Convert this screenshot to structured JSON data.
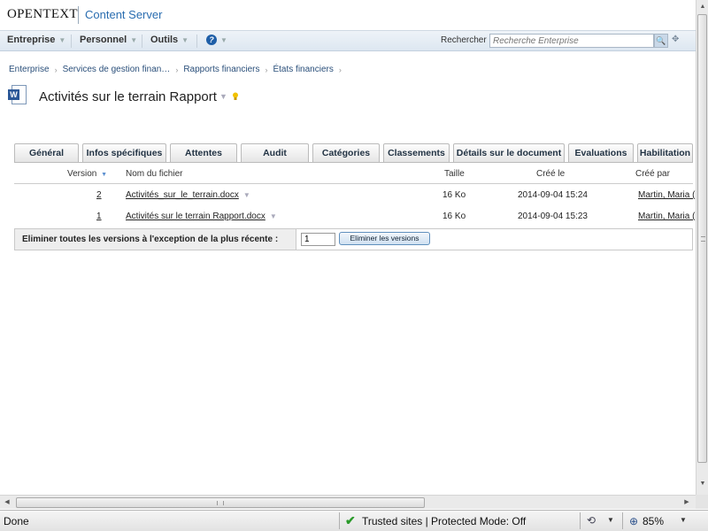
{
  "header": {
    "logo": "OPENTEXT",
    "product": "Content Server"
  },
  "nav": {
    "items": [
      "Entreprise",
      "Personnel",
      "Outils"
    ],
    "help_glyph": "?",
    "search_label": "Rechercher",
    "search_placeholder": "Recherche Enterprise"
  },
  "breadcrumb": [
    "Enterprise",
    "Services de gestion finan…",
    "Rapports financiers",
    "États financiers"
  ],
  "page": {
    "title": "Activités sur le terrain Rapport",
    "icon": "word-document-icon"
  },
  "tabs": [
    "Général",
    "Infos spécifiques",
    "Attentes",
    "Audit",
    "Catégories",
    "Classements",
    "Détails sur le document",
    "Evaluations",
    "Habilitation"
  ],
  "table": {
    "headers": {
      "version": "Version",
      "filename": "Nom du fichier",
      "size": "Taille",
      "created": "Créé le",
      "created_by": "Créé par"
    },
    "rows": [
      {
        "version": "2",
        "filename": "Activités_sur_le_terrain.docx",
        "size": "16 Ko",
        "created": "2014-09-04 15:24",
        "created_by": "Martin, Maria ("
      },
      {
        "version": "1",
        "filename": "Activités sur le terrain Rapport.docx",
        "size": "16 Ko",
        "created": "2014-09-04 15:23",
        "created_by": "Martin, Maria ("
      }
    ]
  },
  "purge": {
    "label": "Eliminer toutes les versions à l'exception de la plus récente :",
    "value": "1",
    "button": "Eliminer les versions"
  },
  "statusbar": {
    "status": "Done",
    "zone": "Trusted sites | Protected Mode: Off",
    "zoom": "85%"
  },
  "colors": {
    "accent": "#2a6db0",
    "nav_bg": "#dde7f1",
    "trusted_check": "#2a9a2a"
  }
}
